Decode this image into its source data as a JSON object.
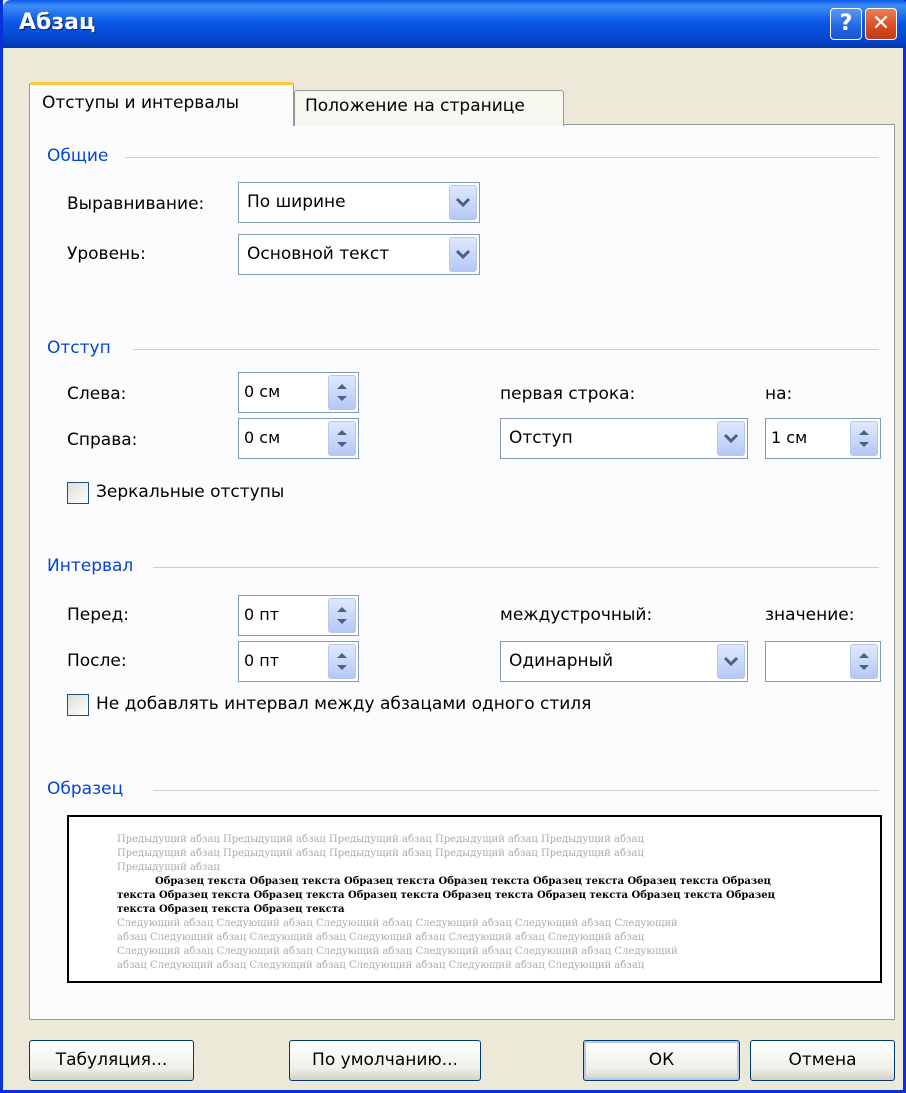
{
  "window": {
    "title": "Абзац",
    "help_label": "?",
    "close_label": "✕"
  },
  "tabs": [
    {
      "label": "Отступы и интервалы",
      "active": true
    },
    {
      "label": "Положение на странице",
      "active": false
    }
  ],
  "general": {
    "section_title": "Общие",
    "alignment_label": "Выравнивание:",
    "alignment_value": "По ширине",
    "level_label": "Уровень:",
    "level_value": "Основной текст"
  },
  "indent": {
    "section_title": "Отступ",
    "left_label": "Слева:",
    "left_value": "0 см",
    "right_label": "Справа:",
    "right_value": "0 см",
    "first_line_label": "первая строка:",
    "first_line_value": "Отступ",
    "by_label": "на:",
    "by_value": "1 см",
    "mirror_label": "Зеркальные отступы",
    "mirror_checked": false
  },
  "spacing": {
    "section_title": "Интервал",
    "before_label": "Перед:",
    "before_value": "0 пт",
    "after_label": "После:",
    "after_value": "0 пт",
    "line_spacing_label": "междустрочный:",
    "line_spacing_value": "Одинарный",
    "at_label": "значение:",
    "at_value": "",
    "dont_add_label": "Не добавлять интервал между абзацами одного стиля",
    "dont_add_checked": false
  },
  "preview": {
    "section_title": "Образец",
    "prev_lines": [
      "Предыдущий абзац Предыдущий абзац Предыдущий абзац Предыдущий абзац Предыдущий абзац",
      "Предыдущий абзац Предыдущий абзац Предыдущий абзац Предыдущий абзац Предыдущий абзац",
      "Предыдущий абзац"
    ],
    "sample_lines": [
      "Образец текста Образец текста Образец текста Образец текста Образец текста Образец текста Образец",
      "текста Образец текста Образец текста Образец текста Образец текста Образец текста Образец текста Образец",
      "текста Образец текста Образец текста"
    ],
    "next_lines": [
      "Следующий абзац Следующий абзац Следующий абзац Следующий абзац Следующий абзац Следующий",
      "абзац Следующий абзац Следующий абзац Следующий абзац Следующий абзац Следующий абзац",
      "Следующий абзац Следующий абзац Следующий абзац Следующий абзац Следующий абзац Следующий",
      "абзац Следующий абзац Следующий абзац Следующий абзац Следующий абзац Следующий абзац"
    ]
  },
  "buttons": {
    "tabs": "Табуляция...",
    "default": "По умолчанию...",
    "ok": "ОК",
    "cancel": "Отмена"
  }
}
